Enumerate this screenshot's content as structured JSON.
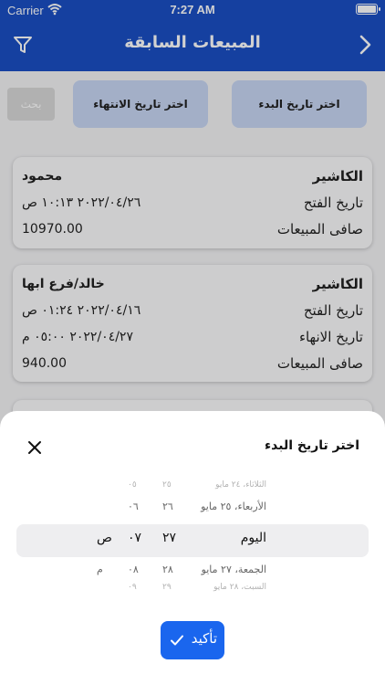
{
  "status_bar": {
    "carrier": "Carrier",
    "time": "7:27 AM"
  },
  "header": {
    "title": "المبيعات السابقة"
  },
  "filters": {
    "start_date_label": "اختر تاريخ البدء",
    "end_date_label": "اختر تاريخ الانتهاء",
    "search_label": "بحث"
  },
  "cards": [
    {
      "cashier_label": "الكاشير",
      "cashier": "محمود",
      "open_label": "تاريخ الفتح",
      "open_value": "٢٠٢٢/٠٤/٢٦ ١٠:١٣ ص",
      "net_label": "صافى المبيعات",
      "net_value": "10970.00"
    },
    {
      "cashier_label": "الكاشير",
      "cashier": "خالد/فرع ابها",
      "open_label": "تاريخ الفتح",
      "open_value": "٢٠٢٢/٠٤/١٦ ٠١:٢٤ ص",
      "close_label": "تاريخ الانهاء",
      "close_value": "٢٠٢٢/٠٤/٢٧ ٠٥:٠٠ م",
      "net_label": "صافى المبيعات",
      "net_value": "940.00"
    }
  ],
  "sheet": {
    "title": "اختر تاريخ البدء",
    "confirm_label": "تأكيد",
    "picker_rows": [
      {
        "day": "الثلاثاء، ٢٤ مايو",
        "hour": "٢٥",
        "minute": "٠٥",
        "ampm": ""
      },
      {
        "day": "الأربعاء، ٢٥ مايو",
        "hour": "٢٦",
        "minute": "٠٦",
        "ampm": ""
      },
      {
        "day": "اليوم",
        "hour": "٢٧",
        "minute": "٠٧",
        "ampm": "ص"
      },
      {
        "day": "الجمعة، ٢٧ مايو",
        "hour": "٢٨",
        "minute": "٠٨",
        "ampm": "م"
      },
      {
        "day": "السبت، ٢٨ مايو",
        "hour": "٢٩",
        "minute": "٠٩",
        "ampm": ""
      }
    ]
  },
  "colors": {
    "primary": "#1a4fc4",
    "confirm": "#1a66ee",
    "date_button": "#c7d6f3"
  }
}
